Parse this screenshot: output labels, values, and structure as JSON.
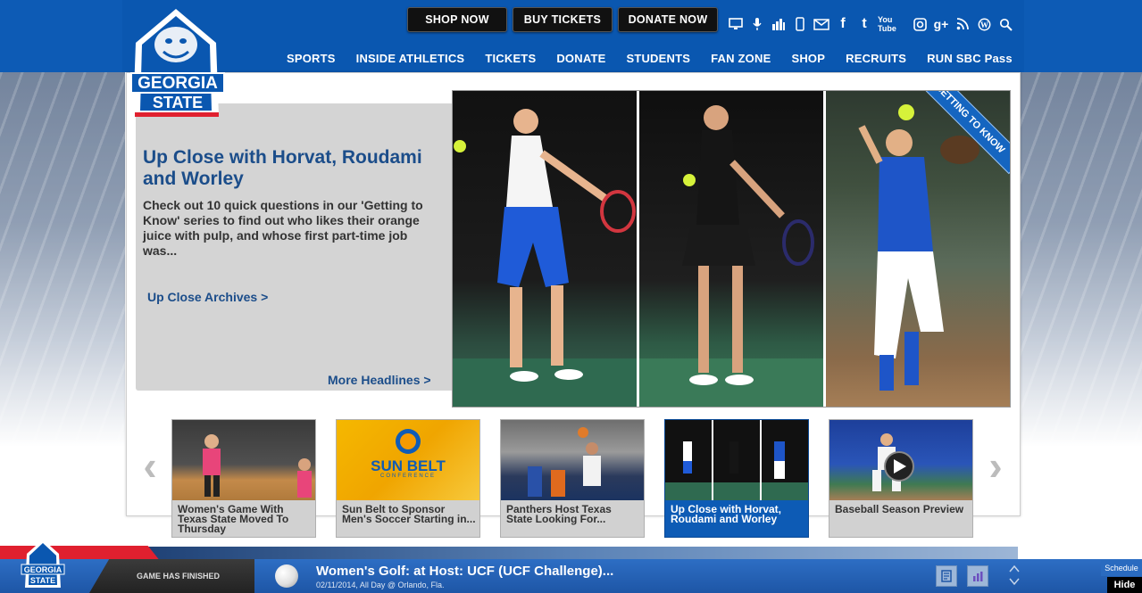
{
  "logo": {
    "line1": "GEORGIA",
    "line2": "STATE"
  },
  "top_buttons": {
    "shop": "SHOP NOW",
    "tickets": "BUY TICKETS",
    "donate": "DONATE NOW"
  },
  "social_icons": [
    "tv-icon",
    "microphone-icon",
    "stats-icon",
    "mobile-icon",
    "email-icon",
    "facebook-icon",
    "twitter-icon",
    "youtube-icon",
    "instagram-icon",
    "google-plus-icon",
    "rss-icon",
    "wordpress-icon",
    "search-icon"
  ],
  "social_labels": {
    "facebook": "f",
    "twitter": "t",
    "youtube": "You Tube",
    "gplus": "g+"
  },
  "nav": [
    "SPORTS",
    "INSIDE ATHLETICS",
    "TICKETS",
    "DONATE",
    "STUDENTS",
    "FAN ZONE",
    "SHOP",
    "RECRUITS",
    "RUN SBC Pass"
  ],
  "feature": {
    "title": "Up Close with Horvat, Roudami and Worley",
    "body": "Check out 10 quick questions in our 'Getting to Know' series to find out who likes their orange juice with pulp, and whose first part-time job was...",
    "archives_link": "Up Close Archives >",
    "more_link": "More Headlines >",
    "ribbon": "GETTING TO KNOW"
  },
  "carousel": {
    "prev": "‹",
    "next": "›",
    "items": [
      {
        "caption": "Women's Game With Texas State Moved To Thursday"
      },
      {
        "caption": "Sun Belt to Sponsor Men's Soccer Starting in..."
      },
      {
        "caption": "Panthers Host Texas State Looking For..."
      },
      {
        "caption": "Up Close with Horvat, Roudami and Worley"
      },
      {
        "caption": "Baseball Season Preview"
      }
    ],
    "sunbelt_logo": "SUN BELT",
    "sunbelt_sub": "CONFERENCE"
  },
  "scorebar": {
    "status": "GAME HAS FINISHED",
    "event_title": "Women's Golf: at Host: UCF (UCF Challenge)...",
    "event_sub": "02/11/2014, All Day @ Orlando, Fla.",
    "schedule": "Schedule",
    "hide": "Hide"
  },
  "colors": {
    "brand_blue": "#0a57b0",
    "accent_red": "#e0202f"
  }
}
